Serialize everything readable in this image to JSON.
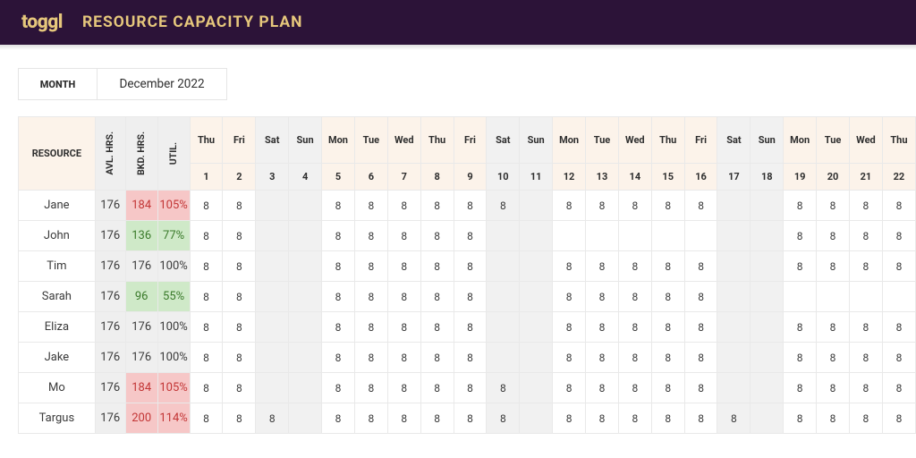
{
  "header": {
    "logo": "toggl",
    "title": "RESOURCE CAPACITY PLAN"
  },
  "period": {
    "label": "MONTH",
    "value": "December 2022"
  },
  "columns": {
    "resource": "RESOURCE",
    "avl": "AVL. HRS.",
    "bkd": "BKD. HRS.",
    "util": "UTIL."
  },
  "days": [
    {
      "dow": "Thu",
      "num": "1",
      "weekend": false
    },
    {
      "dow": "Fri",
      "num": "2",
      "weekend": false
    },
    {
      "dow": "Sat",
      "num": "3",
      "weekend": true
    },
    {
      "dow": "Sun",
      "num": "4",
      "weekend": true
    },
    {
      "dow": "Mon",
      "num": "5",
      "weekend": false
    },
    {
      "dow": "Tue",
      "num": "6",
      "weekend": false
    },
    {
      "dow": "Wed",
      "num": "7",
      "weekend": false
    },
    {
      "dow": "Thu",
      "num": "8",
      "weekend": false
    },
    {
      "dow": "Fri",
      "num": "9",
      "weekend": false
    },
    {
      "dow": "Sat",
      "num": "10",
      "weekend": true
    },
    {
      "dow": "Sun",
      "num": "11",
      "weekend": true
    },
    {
      "dow": "Mon",
      "num": "12",
      "weekend": false
    },
    {
      "dow": "Tue",
      "num": "13",
      "weekend": false
    },
    {
      "dow": "Wed",
      "num": "14",
      "weekend": false
    },
    {
      "dow": "Thu",
      "num": "15",
      "weekend": false
    },
    {
      "dow": "Fri",
      "num": "16",
      "weekend": false
    },
    {
      "dow": "Sat",
      "num": "17",
      "weekend": true
    },
    {
      "dow": "Sun",
      "num": "18",
      "weekend": true
    },
    {
      "dow": "Mon",
      "num": "19",
      "weekend": false
    },
    {
      "dow": "Tue",
      "num": "20",
      "weekend": false
    },
    {
      "dow": "Wed",
      "num": "21",
      "weekend": false
    },
    {
      "dow": "Thu",
      "num": "22",
      "weekend": false
    }
  ],
  "rows": [
    {
      "name": "Jane",
      "avl": "176",
      "bkd": "184",
      "util": "105%",
      "status": "over",
      "cells": [
        "8",
        "8",
        "",
        "",
        "8",
        "8",
        "8",
        "8",
        "8",
        "8",
        "",
        "8",
        "8",
        "8",
        "8",
        "8",
        "",
        "",
        "8",
        "8",
        "8",
        "8"
      ]
    },
    {
      "name": "John",
      "avl": "176",
      "bkd": "136",
      "util": "77%",
      "status": "under",
      "cells": [
        "8",
        "8",
        "",
        "",
        "8",
        "8",
        "8",
        "8",
        "8",
        "",
        "",
        "",
        "",
        "",
        "",
        "",
        "",
        "",
        "8",
        "8",
        "8",
        "8"
      ]
    },
    {
      "name": "Tim",
      "avl": "176",
      "bkd": "176",
      "util": "100%",
      "status": "normal",
      "cells": [
        "8",
        "8",
        "",
        "",
        "8",
        "8",
        "8",
        "8",
        "8",
        "",
        "",
        "8",
        "8",
        "8",
        "8",
        "8",
        "",
        "",
        "8",
        "8",
        "8",
        "8"
      ]
    },
    {
      "name": "Sarah",
      "avl": "176",
      "bkd": "96",
      "util": "55%",
      "status": "under",
      "cells": [
        "8",
        "8",
        "",
        "",
        "8",
        "8",
        "8",
        "8",
        "8",
        "",
        "",
        "8",
        "8",
        "8",
        "8",
        "8",
        "",
        "",
        "",
        "",
        "",
        ""
      ]
    },
    {
      "name": "Eliza",
      "avl": "176",
      "bkd": "176",
      "util": "100%",
      "status": "normal",
      "cells": [
        "8",
        "8",
        "",
        "",
        "8",
        "8",
        "8",
        "8",
        "8",
        "",
        "",
        "8",
        "8",
        "8",
        "8",
        "8",
        "",
        "",
        "8",
        "8",
        "8",
        "8"
      ]
    },
    {
      "name": "Jake",
      "avl": "176",
      "bkd": "176",
      "util": "100%",
      "status": "normal",
      "cells": [
        "8",
        "8",
        "",
        "",
        "8",
        "8",
        "8",
        "8",
        "8",
        "",
        "",
        "8",
        "8",
        "8",
        "8",
        "8",
        "",
        "",
        "8",
        "8",
        "8",
        "8"
      ]
    },
    {
      "name": "Mo",
      "avl": "176",
      "bkd": "184",
      "util": "105%",
      "status": "over",
      "cells": [
        "8",
        "8",
        "",
        "",
        "8",
        "8",
        "8",
        "8",
        "8",
        "8",
        "",
        "8",
        "8",
        "8",
        "8",
        "8",
        "",
        "",
        "8",
        "8",
        "8",
        "8"
      ]
    },
    {
      "name": "Targus",
      "avl": "176",
      "bkd": "200",
      "util": "114%",
      "status": "over",
      "cells": [
        "8",
        "8",
        "8",
        "",
        "8",
        "8",
        "8",
        "8",
        "8",
        "8",
        "",
        "8",
        "8",
        "8",
        "8",
        "8",
        "8",
        "",
        "8",
        "8",
        "8",
        "8"
      ]
    }
  ]
}
